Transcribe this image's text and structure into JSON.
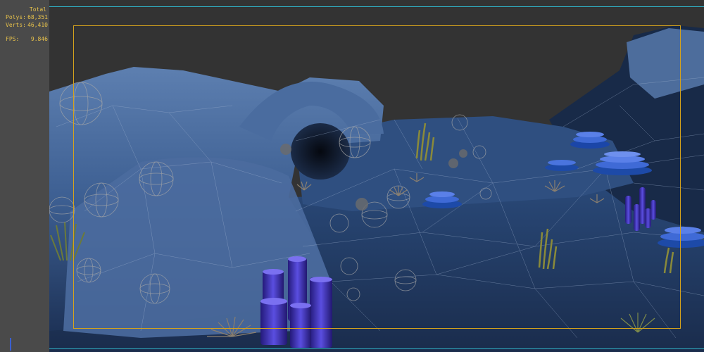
{
  "stats": {
    "header": "Total",
    "polys_label": "Polys:",
    "polys_value": "68,351",
    "verts_label": "Verts:",
    "verts_value": "46,410",
    "fps_label": "FPS:",
    "fps_value": "9.846"
  },
  "colors": {
    "viewport_bg": "#333333",
    "stats_text": "#e8c24a",
    "safe_frame": "#d4a21c",
    "viewport_border": "#2fb3c8",
    "terrain": "#3e5f8c",
    "wireframe": "#8fa3c2",
    "sponge": "#3a2fa8"
  }
}
